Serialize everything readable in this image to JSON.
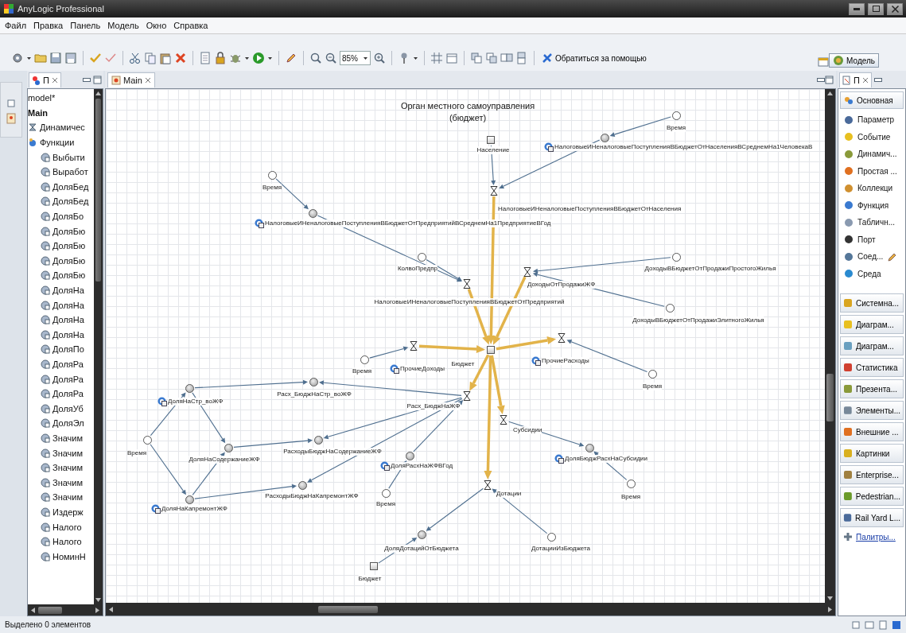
{
  "window": {
    "title": "AnyLogic Professional"
  },
  "menu": [
    "Файл",
    "Правка",
    "Панель",
    "Модель",
    "Окно",
    "Справка"
  ],
  "toolbar": {
    "zoom": "85%",
    "help_button": "Обратиться за помощью",
    "perspective": "Модель"
  },
  "project_panel": {
    "tab": "П",
    "tree": [
      {
        "kind": "model",
        "label": "model*"
      },
      {
        "kind": "agent",
        "label": "Main",
        "children": [
          {
            "kind": "dynamics",
            "label": "Динамичес"
          },
          {
            "kind": "folder",
            "label": "Функции",
            "children": [
              {
                "kind": "function",
                "label": "Выбыти"
              },
              {
                "kind": "function",
                "label": "Выработ"
              },
              {
                "kind": "function",
                "label": "ДоляБед"
              },
              {
                "kind": "function",
                "label": "ДоляБед"
              },
              {
                "kind": "function",
                "label": "ДоляБо"
              },
              {
                "kind": "function",
                "label": "ДоляБю"
              },
              {
                "kind": "function",
                "label": "ДоляБю"
              },
              {
                "kind": "function",
                "label": "ДоляБю"
              },
              {
                "kind": "function",
                "label": "ДоляБю"
              },
              {
                "kind": "function",
                "label": "ДоляНа"
              },
              {
                "kind": "function",
                "label": "ДоляНа"
              },
              {
                "kind": "function",
                "label": "ДоляНа"
              },
              {
                "kind": "function",
                "label": "ДоляНа"
              },
              {
                "kind": "function",
                "label": "ДоляПо"
              },
              {
                "kind": "function",
                "label": "ДоляРа"
              },
              {
                "kind": "function",
                "label": "ДоляРа"
              },
              {
                "kind": "function",
                "label": "ДоляРа"
              },
              {
                "kind": "function",
                "label": "ДоляУб"
              },
              {
                "kind": "function",
                "label": "ДоляЭл"
              },
              {
                "kind": "function",
                "label": "Значим"
              },
              {
                "kind": "function",
                "label": "Значим"
              },
              {
                "kind": "function",
                "label": "Значим"
              },
              {
                "kind": "function",
                "label": "Значим"
              },
              {
                "kind": "function",
                "label": "Значим"
              },
              {
                "kind": "function",
                "label": "Издерж"
              },
              {
                "kind": "function",
                "label": "Налого"
              },
              {
                "kind": "function",
                "label": "Налого"
              },
              {
                "kind": "function",
                "label": "НоминН"
              }
            ]
          }
        ]
      }
    ]
  },
  "editor": {
    "tab": "Main",
    "diagram": {
      "title": "Орган местного самоуправления\n(бюджет)",
      "nodes": [
        {
          "kind": "stock",
          "label": "Население"
        },
        {
          "kind": "parameter",
          "label": "Время"
        },
        {
          "kind": "dynamic"
        },
        {
          "kind": "table_function",
          "label": "НалоговыеИНеналоговыеПоступленияВБюджетОтНаселенияВСреднемНа1ЧеловекаВ"
        },
        {
          "kind": "flow",
          "label": "НалоговыеИНеналоговыеПоступленияВБюджетОтНаселения"
        },
        {
          "kind": "parameter",
          "label": "Время"
        },
        {
          "kind": "dynamic"
        },
        {
          "kind": "table_function",
          "label": "НалоговыеИНеналоговыеПоступленияВБюджетОтПредприятийВСреднемНа1ПредприятиеВГод"
        },
        {
          "kind": "parameter",
          "label": "КолвоПредпр"
        },
        {
          "kind": "flow",
          "label": "НалоговыеИНеналоговыеПоступленияВБюджетОтПредприятий"
        },
        {
          "kind": "flow",
          "label": "ДоходыОтПродажиЖФ"
        },
        {
          "kind": "parameter",
          "label": "ДоходыВБюджетОтПродажиПростогоЖилья"
        },
        {
          "kind": "parameter",
          "label": "ДоходыВБюджетОтПродажиЭлитногоЖилья"
        },
        {
          "kind": "stock",
          "label": "Бюджет"
        },
        {
          "kind": "flow"
        },
        {
          "kind": "parameter",
          "label": "Время"
        },
        {
          "kind": "table_function",
          "label": "ПрочиеДоходы"
        },
        {
          "kind": "flow"
        },
        {
          "kind": "table_function",
          "label": "ПрочиеРасходы"
        },
        {
          "kind": "parameter",
          "label": "Время"
        },
        {
          "kind": "flow",
          "label": "Расх_БюджНаЖФ"
        },
        {
          "kind": "dynamic",
          "label": "Расх_БюджНаСтр_воЖФ"
        },
        {
          "kind": "dynamic"
        },
        {
          "kind": "table_function",
          "label": "ДоляНаСтр_воЖФ"
        },
        {
          "kind": "parameter",
          "label": "Время"
        },
        {
          "kind": "dynamic",
          "label": "ДоляНаСодержаниеЖФ"
        },
        {
          "kind": "dynamic",
          "label": "РасходыБюджНаСодержаниеЖФ"
        },
        {
          "kind": "dynamic"
        },
        {
          "kind": "table_function",
          "label": "ДоляНаКапремонтЖФ"
        },
        {
          "kind": "dynamic",
          "label": "РасходыБюджНаКапремонтЖФ"
        },
        {
          "kind": "dynamic"
        },
        {
          "kind": "table_function",
          "label": "ДоляРасхНаЖФВГод"
        },
        {
          "kind": "parameter",
          "label": "Время"
        },
        {
          "kind": "flow",
          "label": "Субсидии"
        },
        {
          "kind": "dynamic"
        },
        {
          "kind": "table_function",
          "label": "ДоляБюджРасхНаСубсидии"
        },
        {
          "kind": "parameter",
          "label": "Время"
        },
        {
          "kind": "flow",
          "label": "Дотации"
        },
        {
          "kind": "dynamic",
          "label": "ДоляДотацийОтБюджета"
        },
        {
          "kind": "parameter",
          "label": "ДотацииИзБюджета"
        },
        {
          "kind": "stock",
          "label": "Бюджет"
        }
      ]
    }
  },
  "palette": {
    "tab": "П",
    "section": "Основная",
    "items": [
      {
        "label": "Параметр"
      },
      {
        "label": "Событие"
      },
      {
        "label": "Динамич..."
      },
      {
        "label": "Простая ..."
      },
      {
        "label": "Коллекци"
      },
      {
        "label": "Функция"
      },
      {
        "label": "Табличн..."
      },
      {
        "label": "Порт"
      },
      {
        "label": "Соед..."
      },
      {
        "label": "Среда"
      }
    ],
    "groups": [
      "Системна...",
      "Диаграм...",
      "Диаграм...",
      "Статистика",
      "Презента...",
      "Элементы...",
      "Внешние ...",
      "Картинки",
      "Enterprise...",
      "Pedestrian...",
      "Rail Yard L..."
    ],
    "link": "Палитры..."
  },
  "status_bar": "Выделено 0 элементов"
}
